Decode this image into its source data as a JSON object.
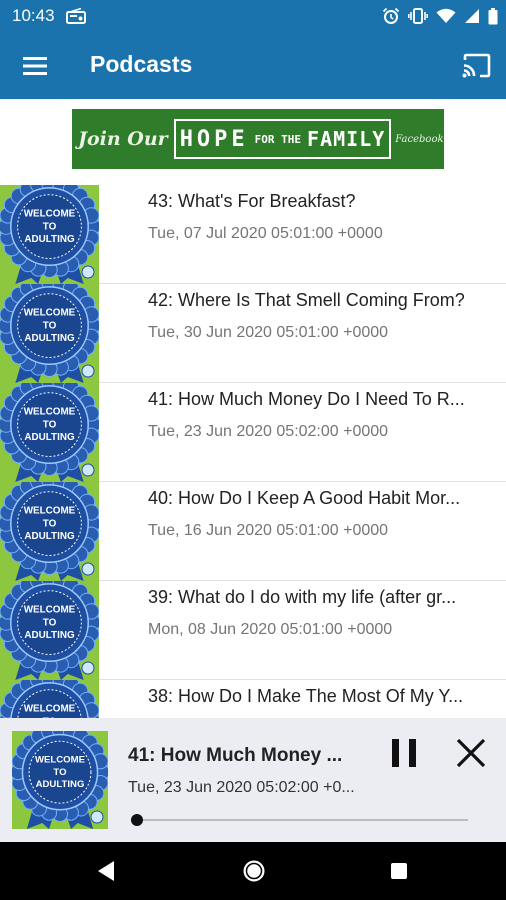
{
  "status_bar": {
    "time": "10:43",
    "icons": [
      "radio-icon",
      "alarm-icon",
      "vibrate-icon",
      "wifi-icon",
      "signal-icon",
      "battery-icon"
    ]
  },
  "app_bar": {
    "title": "Podcasts",
    "menu_icon": "hamburger-menu-icon",
    "cast_icon": "cast-icon",
    "background": "#1a73ad"
  },
  "banner": {
    "join": "Join Our",
    "hope": "HOPE",
    "for_the": "FOR THE",
    "family": "FAMILY",
    "facebook": "Facebook Gr"
  },
  "thumbnail": {
    "line1": "WELCOME",
    "line2": "TO",
    "line3": "ADULTING",
    "background": "#8dc63f",
    "rosette": "#1e4fa3"
  },
  "episodes": [
    {
      "title": "43: What's For Breakfast?",
      "date": "Tue, 07 Jul 2020 05:01:00 +0000"
    },
    {
      "title": "42: Where Is That Smell Coming From?",
      "date": "Tue, 30 Jun 2020 05:01:00 +0000"
    },
    {
      "title": "41: How Much Money Do I Need To R...",
      "date": "Tue, 23 Jun 2020 05:02:00 +0000"
    },
    {
      "title": "40: How Do I Keep A Good Habit Mor...",
      "date": "Tue, 16 Jun 2020 05:01:00 +0000"
    },
    {
      "title": "39: What do I do with my life (after gr...",
      "date": "Mon, 08 Jun 2020 05:01:00 +0000"
    },
    {
      "title": "38: How Do I Make The Most Of My Y...",
      "date": ""
    }
  ],
  "now_playing": {
    "title": "41: How Much Money ...",
    "date": "Tue, 23 Jun 2020 05:02:00 +0...",
    "progress": 0.01,
    "pause_icon": "pause-icon",
    "close_icon": "close-icon"
  },
  "nav_bar": {
    "icons": [
      "back-icon",
      "home-icon",
      "recents-icon"
    ]
  }
}
